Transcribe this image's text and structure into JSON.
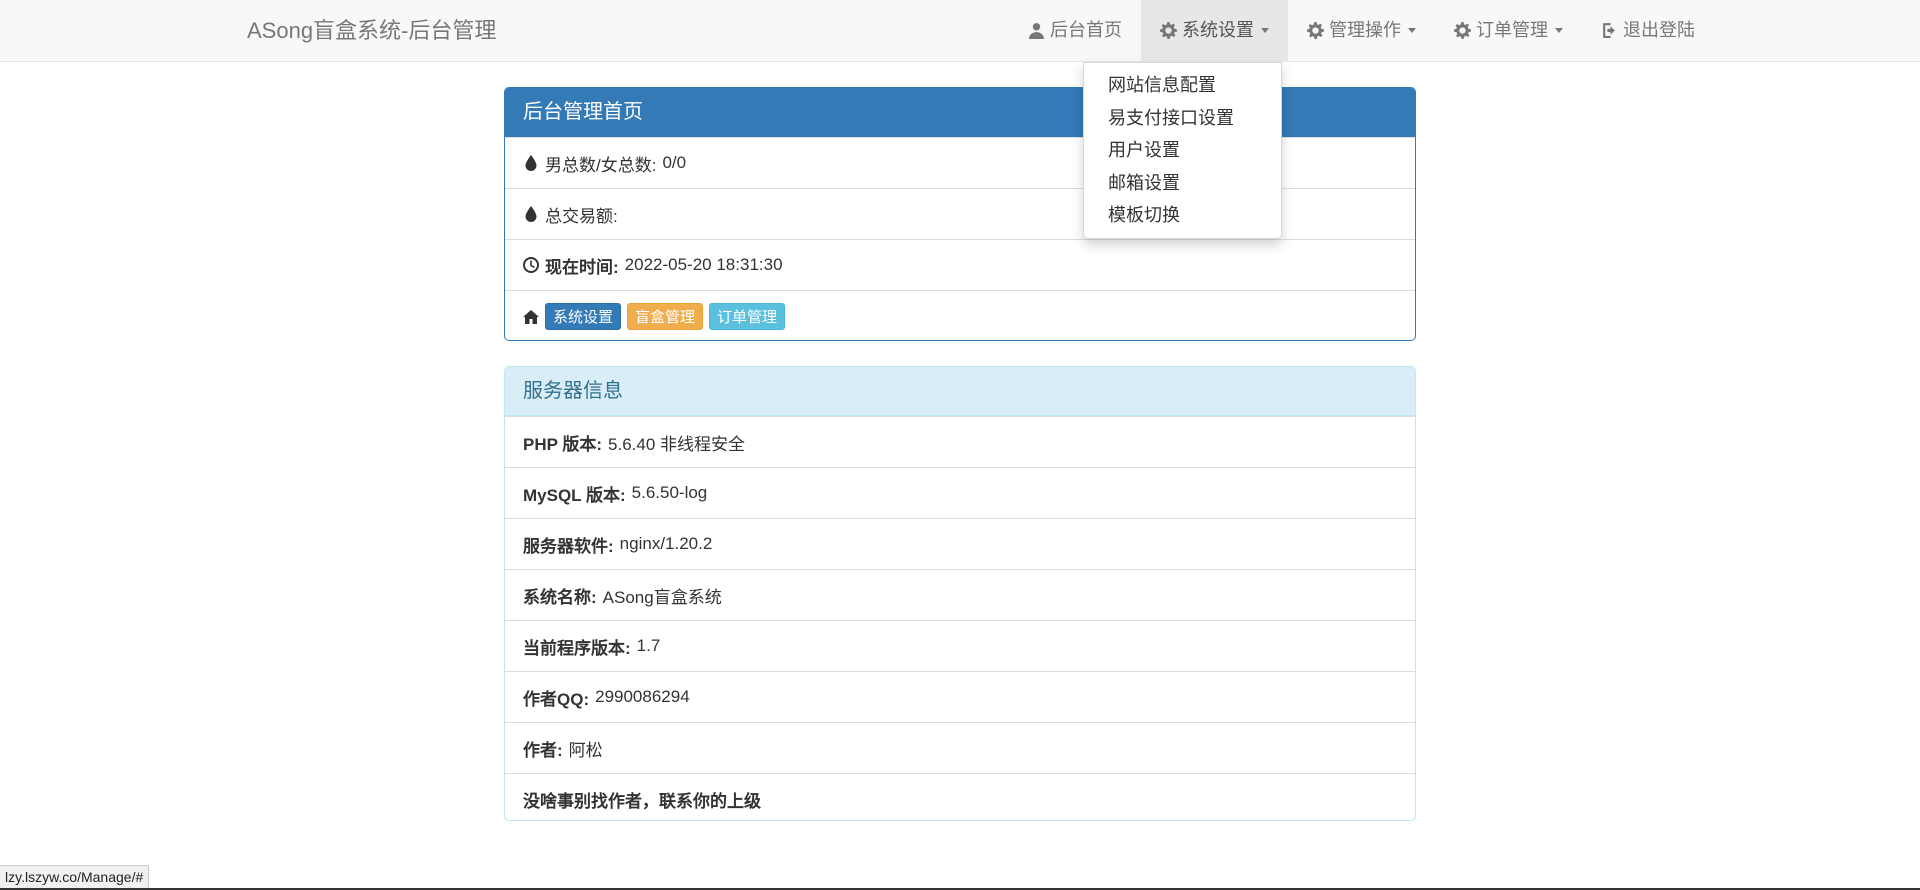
{
  "navbar": {
    "brand": "ASong盲盒系统-后台管理",
    "items": [
      {
        "label": "后台首页",
        "icon": "user-icon",
        "caret": false,
        "active": false
      },
      {
        "label": "系统设置",
        "icon": "gear-icon",
        "caret": true,
        "active": true
      },
      {
        "label": "管理操作",
        "icon": "gear-icon",
        "caret": true,
        "active": false
      },
      {
        "label": "订单管理",
        "icon": "gear-icon",
        "caret": true,
        "active": false
      },
      {
        "label": "退出登陆",
        "icon": "logout-icon",
        "caret": false,
        "active": false
      }
    ]
  },
  "dropdown": {
    "items": [
      "网站信息配置",
      "易支付接口设置",
      "用户设置",
      "邮箱设置",
      "模板切换"
    ]
  },
  "admin_panel": {
    "title": "后台管理首页",
    "gender_label": "男总数/女总数:",
    "gender_value": "0/0",
    "trade_label": "总交易额:",
    "trade_value": "",
    "time_label": "现在时间:",
    "time_value": "2022-05-20 18:31:30",
    "buttons": [
      "系统设置",
      "盲盒管理",
      "订单管理"
    ]
  },
  "server_panel": {
    "title": "服务器信息",
    "rows": [
      {
        "label": "PHP 版本:",
        "value": "5.6.40 非线程安全"
      },
      {
        "label": "MySQL 版本:",
        "value": "5.6.50-log"
      },
      {
        "label": "服务器软件:",
        "value": "nginx/1.20.2"
      },
      {
        "label": "系统名称:",
        "value": "ASong盲盒系统"
      },
      {
        "label": "当前程序版本:",
        "value": "1.7"
      },
      {
        "label": "作者QQ:",
        "value": "2990086294"
      },
      {
        "label": "作者:",
        "value": "阿松"
      },
      {
        "label": "没啥事别找作者，联系你的上级",
        "value": ""
      }
    ]
  },
  "statusbar": {
    "url": "lzy.lszyw.co/Manage/#"
  }
}
